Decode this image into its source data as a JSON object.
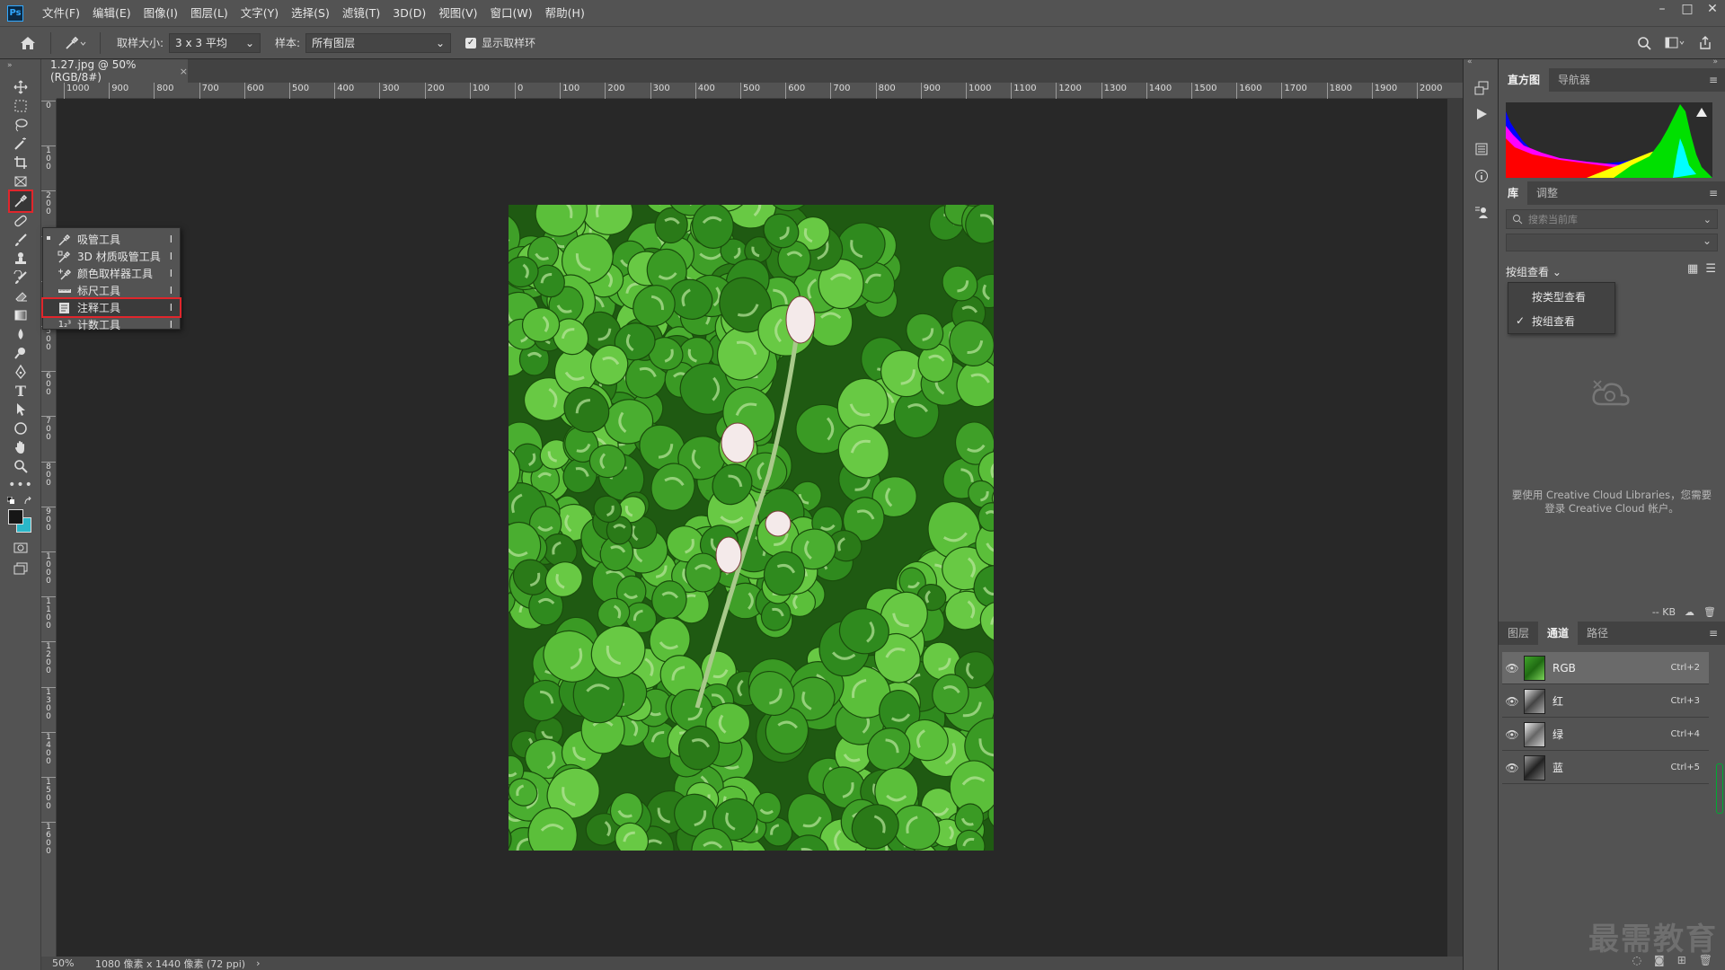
{
  "app": {
    "logo": "Ps"
  },
  "menu": [
    "文件(F)",
    "编辑(E)",
    "图像(I)",
    "图层(L)",
    "文字(Y)",
    "选择(S)",
    "滤镜(T)",
    "3D(D)",
    "视图(V)",
    "窗口(W)",
    "帮助(H)"
  ],
  "window_controls": [
    "–",
    "□",
    "✕"
  ],
  "options": {
    "sample_size_label": "取样大小:",
    "sample_size_value": "3 x 3 平均",
    "sample_label": "样本:",
    "sample_value": "所有图层",
    "show_ring_label": "显示取样环",
    "show_ring_checked": true
  },
  "document": {
    "tab_title": "1.27.jpg @ 50%(RGB/8#)",
    "zoom": "50%",
    "info": "1080 像素 x 1440 像素 (72 ppi)",
    "info_arrow": "›"
  },
  "ruler_top_labels": [
    "1000",
    "900",
    "800",
    "700",
    "600",
    "500",
    "400",
    "300",
    "200",
    "100",
    "0",
    "100",
    "200",
    "300",
    "400",
    "500",
    "600",
    "700",
    "800",
    "900",
    "1000",
    "1100",
    "1200",
    "1300",
    "1400",
    "1500",
    "1600",
    "1700",
    "1800",
    "1900",
    "2000"
  ],
  "ruler_left_labels": [
    "0",
    "1\n0\n0",
    "2\n0\n0",
    "3\n0\n0",
    "4\n0\n0",
    "5\n0\n0",
    "6\n0\n0",
    "7\n0\n0",
    "8\n0\n0",
    "9\n0\n0",
    "1\n0\n0\n0",
    "1\n1\n0\n0",
    "1\n2\n0\n0",
    "1\n3\n0\n0",
    "1\n4\n0\n0",
    "1\n5\n0\n0",
    "1\n6\n0\n0"
  ],
  "toolbar_tools": [
    "move-tool",
    "marquee-tool",
    "lasso-tool",
    "magic-wand-tool",
    "crop-tool",
    "frame-tool",
    "eyedropper-tool",
    "healing-tool",
    "brush-tool",
    "stamp-tool",
    "history-brush-tool",
    "eraser-tool",
    "gradient-tool",
    "blur-tool",
    "dodge-tool",
    "pen-tool",
    "type-tool",
    "path-select-tool",
    "shape-tool",
    "hand-tool",
    "zoom-tool",
    "more-tools"
  ],
  "flyout": [
    {
      "label": "吸管工具",
      "key": "I",
      "icon": "eyedropper-icon",
      "current": true
    },
    {
      "label": "3D 材质吸管工具",
      "key": "I",
      "icon": "3d-eyedropper-icon"
    },
    {
      "label": "颜色取样器工具",
      "key": "I",
      "icon": "color-sampler-icon"
    },
    {
      "label": "标尺工具",
      "key": "I",
      "icon": "ruler-icon"
    },
    {
      "label": "注释工具",
      "key": "I",
      "icon": "note-icon",
      "highlight": true
    },
    {
      "label": "计数工具",
      "key": "I",
      "icon": "count-icon",
      "prefix": "1₂³"
    }
  ],
  "panels": {
    "histogram_tabs": [
      "直方图",
      "导航器"
    ],
    "library_tabs": [
      "库",
      "调整"
    ],
    "library_search_placeholder": "搜索当前库",
    "group_by_label": "按组查看",
    "dropdown_items": [
      {
        "label": "按类型查看",
        "checked": false
      },
      {
        "label": "按组查看",
        "checked": true
      }
    ],
    "library_message": "要使用 Creative Cloud Libraries，您需要登录 Creative Cloud 帐户。",
    "library_size": "-- KB",
    "layers_tabs": [
      "图层",
      "通道",
      "路径"
    ],
    "channels": [
      {
        "name": "RGB",
        "shortcut": "Ctrl+2",
        "selected": true
      },
      {
        "name": "红",
        "shortcut": "Ctrl+3"
      },
      {
        "name": "绿",
        "shortcut": "Ctrl+4"
      },
      {
        "name": "蓝",
        "shortcut": "Ctrl+5"
      }
    ]
  },
  "watermark": "最需教育",
  "colors": {
    "highlight_red": "#e0262c",
    "accent_blue": "#31a8ff"
  }
}
